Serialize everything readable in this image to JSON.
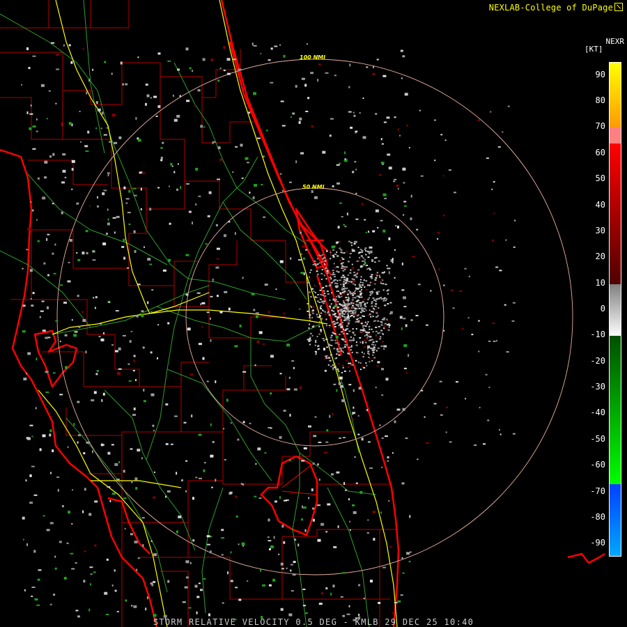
{
  "header": {
    "credit": "NEXLAB-College of DuPage",
    "logo_icon": "corner-mark-icon"
  },
  "legend": {
    "product": "NEXR",
    "unit": "[KT]",
    "ticks": [
      "90",
      "80",
      "70",
      "60",
      "50",
      "40",
      "30",
      "20",
      "10",
      "0",
      "-10",
      "-20",
      "-30",
      "-40",
      "-50",
      "-60",
      "-70",
      "-80",
      "-90"
    ],
    "color_stops": [
      {
        "from": 95,
        "to": 70,
        "color": "#ffff00",
        "to_color": "#ff9900"
      },
      {
        "from": 70,
        "to": 64,
        "color": "#ff8080"
      },
      {
        "from": 64,
        "to": 10,
        "color": "#ff0000",
        "to_color": "#500000"
      },
      {
        "from": 10,
        "to": -10,
        "color": "#808080",
        "to_color": "#ffffff"
      },
      {
        "from": -10,
        "to": -67,
        "color": "#005000",
        "to_color": "#00ff00"
      },
      {
        "from": -67,
        "to": -95,
        "color": "#0040ff",
        "to_color": "#00aaff"
      }
    ]
  },
  "map": {
    "range_rings": [
      "100 NMI",
      "50 NMI"
    ],
    "colors": {
      "county_lines": "#c80000",
      "coastline": "#ff0000",
      "highways": "#ffff00",
      "roads": "#2ba02b",
      "range_rings": "#e8b0a0"
    }
  },
  "footer": {
    "caption": "STORM RELATIVE VELOCITY 0.5 DEG - KMLB 29 DEC 25 10:40"
  }
}
